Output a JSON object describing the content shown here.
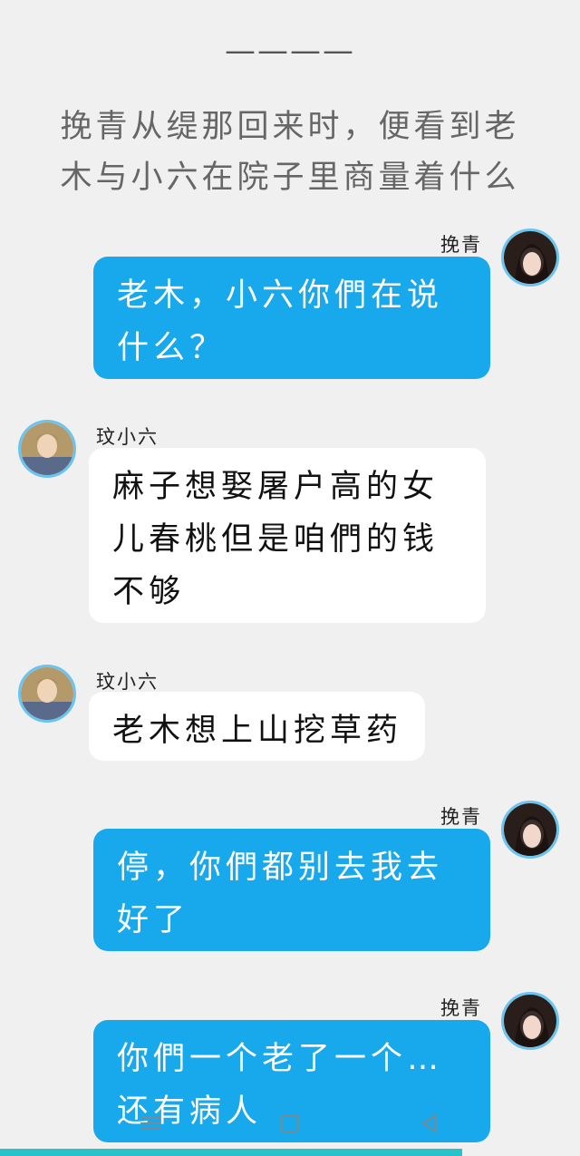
{
  "divider": "————",
  "narration": "挽青从缇那回来时，便看到老木与小六在院子里商量着什么",
  "messages": [
    {
      "sender": "挽青",
      "text": "老木，小六你們在说什么？",
      "side": "right"
    },
    {
      "sender": "玟小六",
      "text": "麻子想娶屠户高的女儿春桃但是咱們的钱不够",
      "side": "left"
    },
    {
      "sender": "玟小六",
      "text": "老木想上山挖草药",
      "side": "left"
    },
    {
      "sender": "挽青",
      "text": "停，你們都别去我去好了",
      "side": "right"
    },
    {
      "sender": "挽青",
      "text": "你們一个老了一个…还有病人",
      "side": "right"
    }
  ],
  "colors": {
    "background": "#f0f0f0",
    "my_bubble": "#18a8ec",
    "other_bubble": "#ffffff",
    "avatar_ring": "#6ac4ef",
    "bottom_bar": "#28c3c8"
  },
  "icons": {
    "nav_menu": "menu-icon",
    "nav_home": "square-home-icon",
    "nav_back": "triangle-back-icon"
  }
}
